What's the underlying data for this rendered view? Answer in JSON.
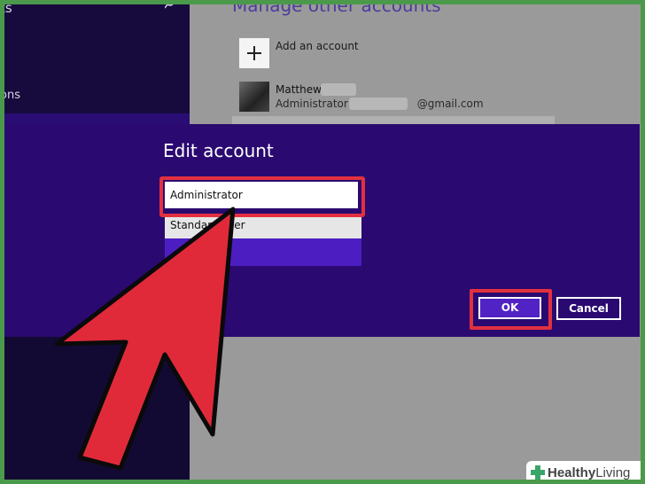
{
  "left_nav": {
    "fragment_1": "ts",
    "fragment_2": "t",
    "fragment_3": "ons"
  },
  "right_pane": {
    "heading": "Manage other accounts",
    "add_account_label": "Add an account",
    "user": {
      "name": "Matthew",
      "role": "Administrator - ",
      "email_suffix": "@gmail.com"
    }
  },
  "dialog": {
    "title": "Edit account",
    "select_value": "Administrator",
    "options": [
      "Standard user",
      ""
    ],
    "ok_label": "OK",
    "cancel_label": "Cancel"
  },
  "watermark": {
    "part_a": "Healthy",
    "part_b": " Living"
  },
  "colors": {
    "dialog_bg": "#2a0a70",
    "highlight_red": "#e3303f",
    "selected_option": "#4c1ec1",
    "arrow_red": "#e02a3a"
  },
  "icons": [
    "search-icon",
    "plus-icon",
    "avatar-photo",
    "pointer-arrow",
    "healthy-living-logo"
  ]
}
